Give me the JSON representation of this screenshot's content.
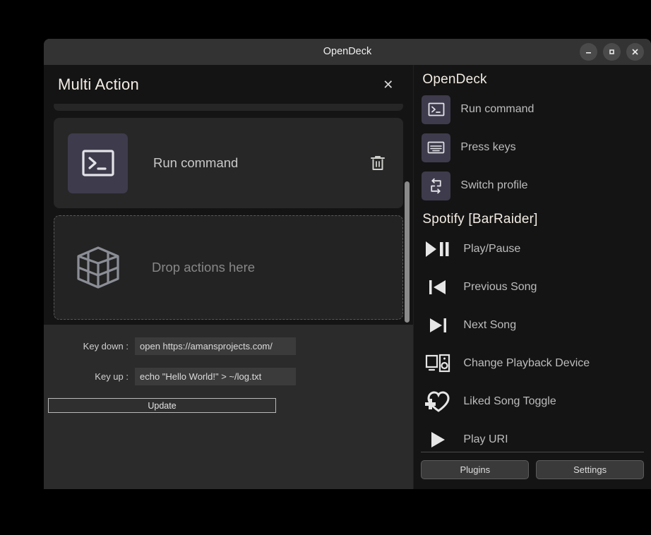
{
  "window": {
    "title": "OpenDeck",
    "controls": [
      {
        "name": "minimize-button",
        "glyph": "minimize"
      },
      {
        "name": "maximize-button",
        "glyph": "maximize"
      },
      {
        "name": "close-button",
        "glyph": "close"
      }
    ]
  },
  "dialog": {
    "title": "Multi Action",
    "close_label": "✕",
    "actions": [
      {
        "label": "Run command",
        "icon": "terminal-icon",
        "delete_icon": "trash-icon"
      }
    ],
    "drop_zone": {
      "label": "Drop actions here",
      "icon": "cube-icon"
    }
  },
  "form": {
    "fields": [
      {
        "label": "Key down :",
        "value": "open https://amansprojects.com/",
        "placeholder": ""
      },
      {
        "label": "Key up :",
        "value": "echo \"Hello World!\" > ~/log.txt",
        "placeholder": ""
      }
    ],
    "update_label": "Update"
  },
  "sidebar": {
    "groups": [
      {
        "title": "OpenDeck",
        "items": [
          {
            "label": "Run command",
            "icon": "terminal-icon",
            "tile": true
          },
          {
            "label": "Press keys",
            "icon": "keyboard-icon",
            "tile": true
          },
          {
            "label": "Switch profile",
            "icon": "swap-arrows-icon",
            "tile": true
          }
        ]
      },
      {
        "title": "Spotify [BarRaider]",
        "items": [
          {
            "label": "Play/Pause",
            "icon": "play-pause-icon",
            "tile": false
          },
          {
            "label": "Previous Song",
            "icon": "previous-track-icon",
            "tile": false
          },
          {
            "label": "Next Song",
            "icon": "next-track-icon",
            "tile": false
          },
          {
            "label": "Change Playback Device",
            "icon": "playback-device-icon",
            "tile": false
          },
          {
            "label": "Liked Song Toggle",
            "icon": "heart-plus-icon",
            "tile": false
          },
          {
            "label": "Play URI",
            "icon": "play-icon",
            "tile": false
          }
        ]
      }
    ],
    "footer": {
      "plugins_label": "Plugins",
      "settings_label": "Settings"
    }
  },
  "colors": {
    "window_bg": "#2b2b2b",
    "titlebar_bg": "#333333",
    "panel_dark": "#141414",
    "card_bg": "#272727",
    "icon_tile": "#3e3b4c",
    "text_primary": "#f3ece4",
    "text_secondary": "#bdbdbd"
  }
}
